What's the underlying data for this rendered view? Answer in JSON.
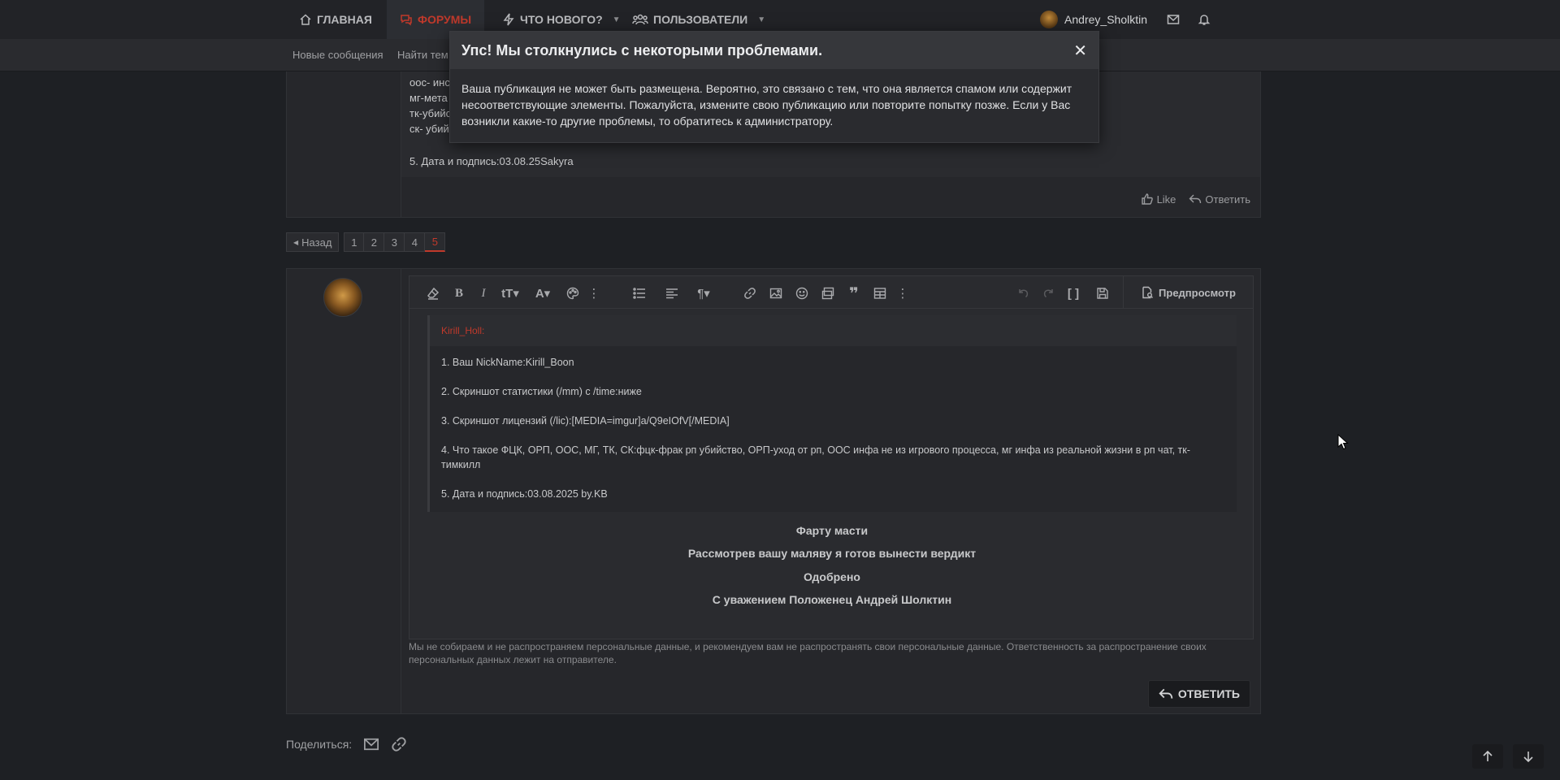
{
  "nav": {
    "home": "Главная",
    "forums": "Форумы",
    "whats_new": "Что нового?",
    "members": "Пользователи",
    "username": "Andrey_Sholktin"
  },
  "subnav": {
    "new_posts": "Новые сообщения",
    "find_threads": "Найти тем"
  },
  "post_top": {
    "frag_1": "оос- инс",
    "frag_2": "мг-мета",
    "frag_3": "тк-убийс",
    "frag_4": "ск- убий",
    "signature": "5. Дата и подпись:03.08.25Sakyra",
    "like": "Like",
    "reply": "Ответить"
  },
  "pager": {
    "back": "Назад",
    "pages": [
      "1",
      "2",
      "3",
      "4",
      "5"
    ],
    "current": "5"
  },
  "editor": {
    "preview": "Предпросмотр",
    "quote_author": "Kirill_Holl:",
    "lines": [
      "1. Ваш NickName:Kirill_Boon",
      "2. Скриншот статистики (/mm) с /time:ниже",
      "3. Скриншот лицензий (/lic):[MEDIA=imgur]a/Q9eIOfV[/MEDIA]",
      "4. Что такое ФЦК, ОРП, ООС, МГ, ТК, СК:фцк-фрак рп убийство, ОРП-уход от рп, ООС инфа не из игрового процесса, мг инфа из реальной жизни в рп чат, тк-тимкилл",
      "5. Дата и подпись:03.08.2025 by.KB"
    ],
    "center": [
      "Фарту масти",
      "Рассмотрев вашу маляву я готов вынести вердикт",
      "Одобрено",
      "С уважением Положенец Андрей Шолктин"
    ]
  },
  "disclaimer": "Мы не собираем и не распространяем персональные данные, и рекомендуем вам не распространять свои персональные данные. Ответственность за распространение своих персональных данных лежит на отправителе.",
  "submit": "Ответить",
  "share_label": "Поделиться:",
  "dialog": {
    "title": "Упс! Мы столкнулись с некоторыми проблемами.",
    "message": "Ваша публикация не может быть размещена. Вероятно, это связано с тем, что она является спамом или содержит несоответствующие элементы. Пожалуйста, измените свою публикацию или повторите попытку позже. Если у Вас возникли какие-то другие проблемы, то обратитесь к администратору."
  },
  "colors": {
    "accent": "#c0392b",
    "background": "#1e2024",
    "panel": "#2a2b2f"
  }
}
